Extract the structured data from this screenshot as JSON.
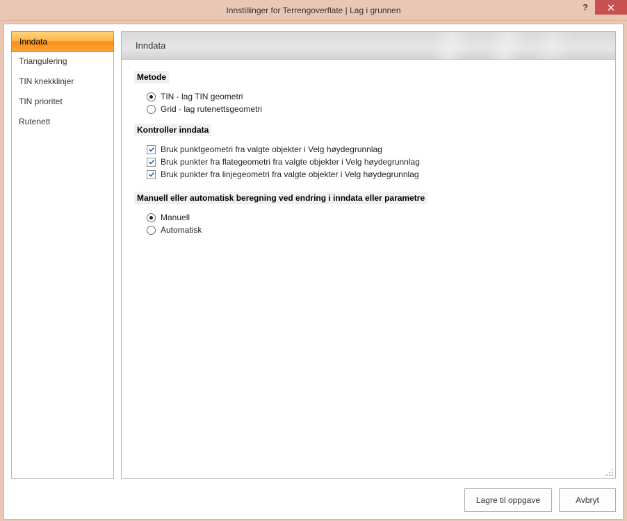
{
  "titlebar": {
    "title": "Innstillinger for Terrengoverflate  |  Lag i grunnen"
  },
  "sidebar": {
    "items": [
      {
        "label": "Inndata",
        "selected": true
      },
      {
        "label": "Triangulering",
        "selected": false
      },
      {
        "label": "TIN knekklinjer",
        "selected": false
      },
      {
        "label": "TIN prioritet",
        "selected": false
      },
      {
        "label": "Rutenett",
        "selected": false
      }
    ]
  },
  "content": {
    "header": "Inndata",
    "section_metode": {
      "title": "Metode",
      "options": [
        {
          "label": "TIN - lag TIN geometri",
          "checked": true
        },
        {
          "label": "Grid - lag rutenettsgeometri",
          "checked": false
        }
      ]
    },
    "section_kontroller": {
      "title": "Kontroller inndata",
      "options": [
        {
          "label": "Bruk punktgeometri fra valgte objekter  i Velg høydegrunnlag",
          "checked": true
        },
        {
          "label": "Bruk punkter fra flategeometri fra valgte objekter  i Velg høydegrunnlag",
          "checked": true
        },
        {
          "label": "Bruk punkter fra linjegeometri fra valgte objekter  i Velg høydegrunnlag",
          "checked": true
        }
      ]
    },
    "section_beregning": {
      "title": "Manuell eller automatisk beregning ved endring i inndata eller parametre",
      "options": [
        {
          "label": "Manuell",
          "checked": true
        },
        {
          "label": "Automatisk",
          "checked": false
        }
      ]
    }
  },
  "footer": {
    "save": "Lagre til oppgave",
    "cancel": "Avbryt"
  }
}
